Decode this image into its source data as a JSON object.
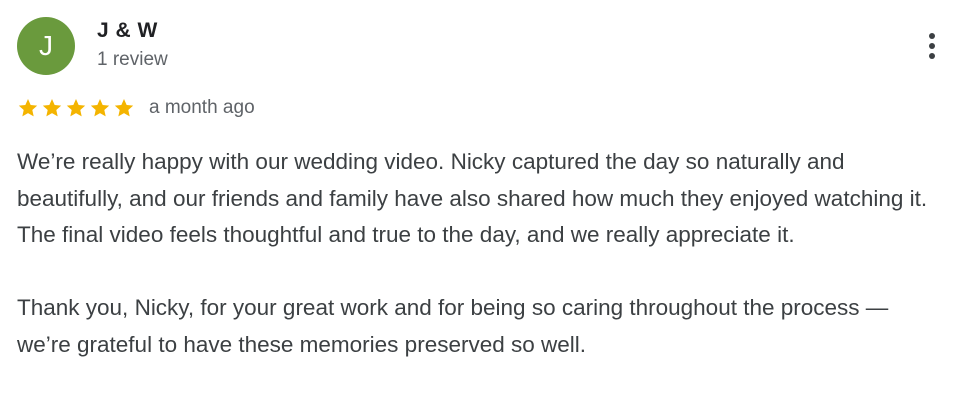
{
  "review": {
    "reviewer": {
      "initial": "J",
      "name": "J & W",
      "review_count": "1 review",
      "avatar_color": "#6a9a3d"
    },
    "rating": {
      "stars": 5,
      "max": 5,
      "star_color": "#f4b400"
    },
    "date": "a month ago",
    "paragraphs": [
      "We’re really happy with our wedding video. Nicky captured the day so naturally and beautifully, and our friends and family have also shared how much they enjoyed watching it. The final video feels thoughtful and true to the day, and we really appreciate it.",
      "Thank you, Nicky, for your great work and for being so caring throughout the process — we’re grateful to have these memories preserved so well."
    ],
    "more_icon": "more-vert-icon"
  }
}
